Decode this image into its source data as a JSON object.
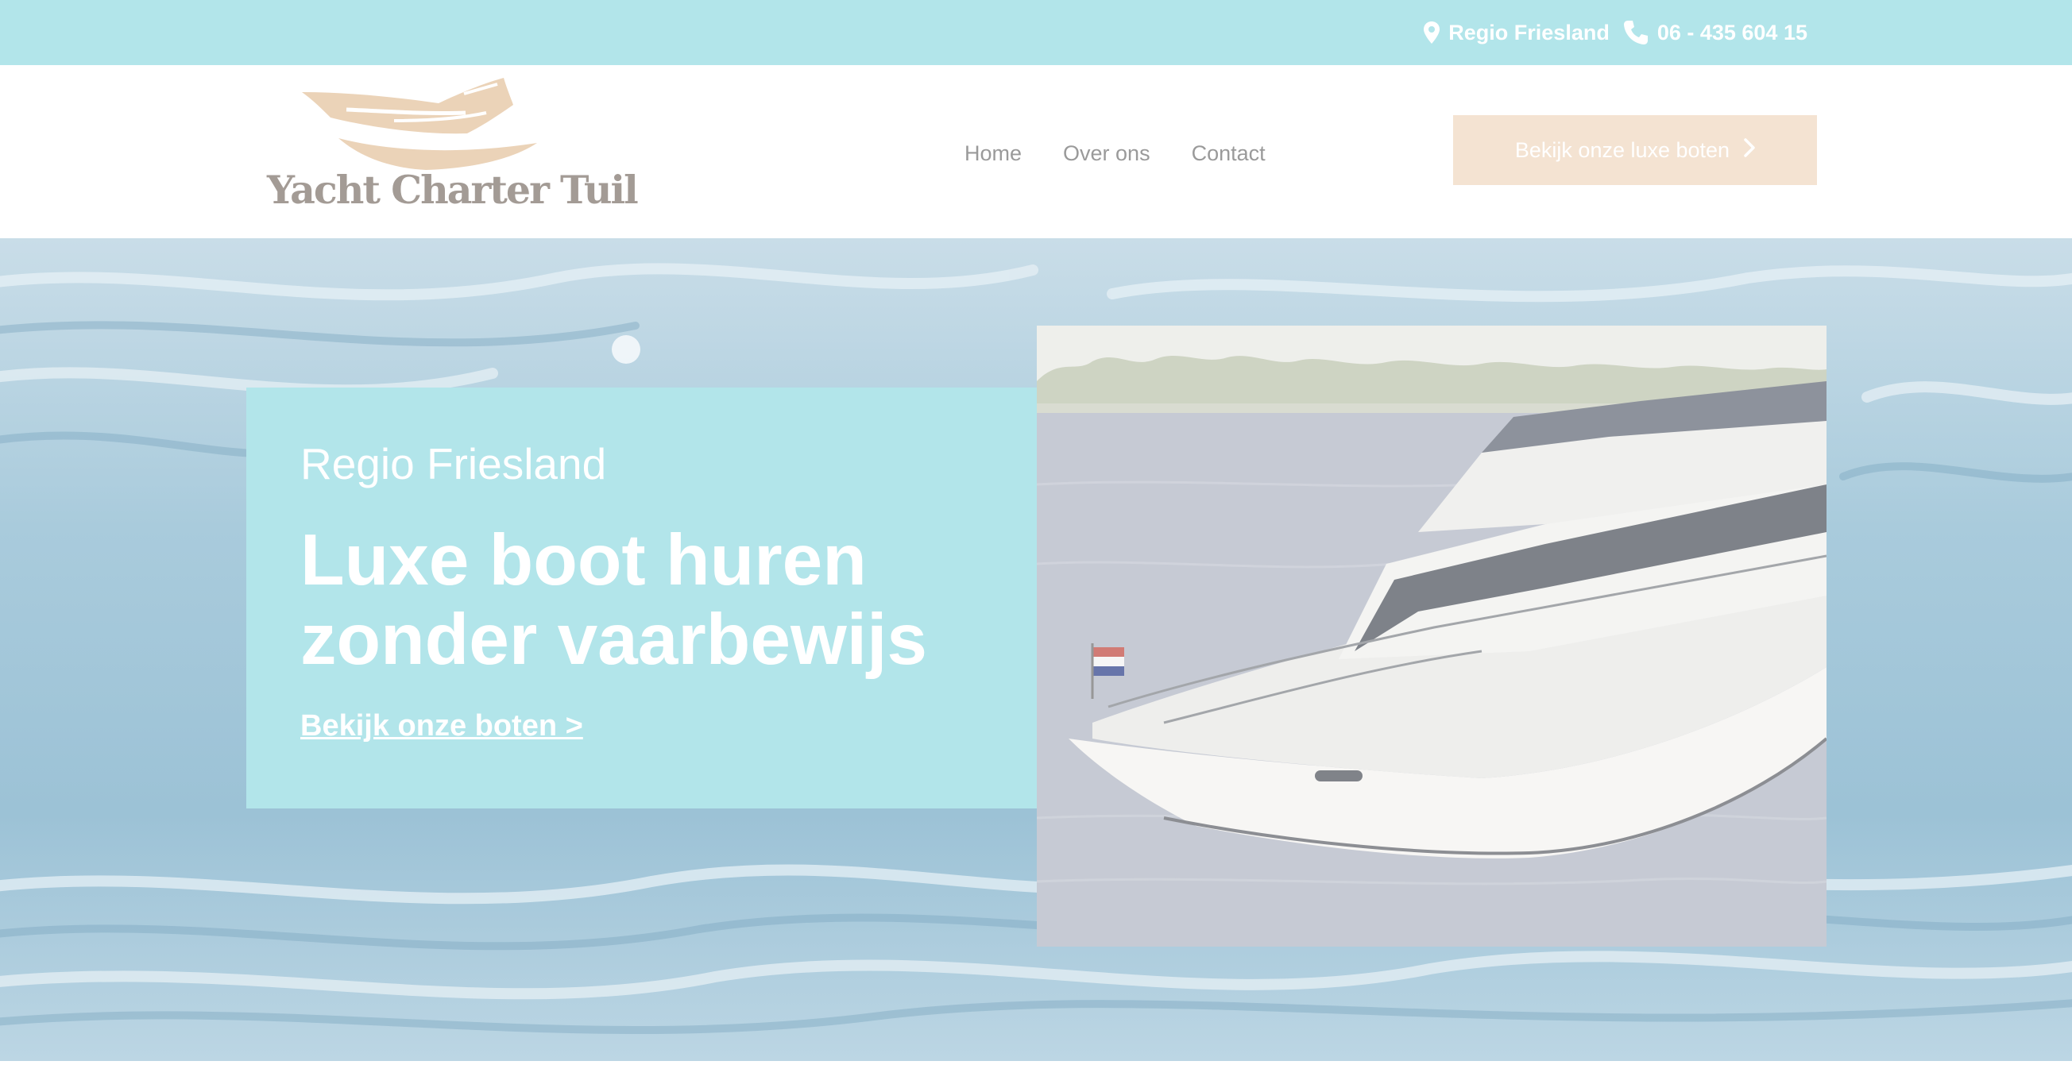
{
  "topbar": {
    "location_icon": "map-pin-icon",
    "location": "Regio Friesland",
    "phone_icon": "phone-icon",
    "phone": "06 - 435 604 15"
  },
  "header": {
    "logo_text": "Yacht Charter Tuil",
    "logo_icon": "yacht-logo-icon",
    "nav": [
      {
        "label": "Home"
      },
      {
        "label": "Over ons"
      },
      {
        "label": "Contact"
      }
    ],
    "cta_label": "Bekijk onze luxe boten",
    "cta_icon": "chevron-right-icon"
  },
  "hero": {
    "subtitle": "Regio Friesland",
    "title": "Luxe boot huren zonder vaarbewijs",
    "link": "Bekijk onze boten >",
    "photo_subject": "yacht-photo"
  },
  "colors": {
    "topbar_bg": "#b2e5ea",
    "accent_cream": "#f4e3d2",
    "card_bg": "#b2e5ea",
    "text_white": "#ffffff",
    "nav_text": "#9a9a9a"
  }
}
